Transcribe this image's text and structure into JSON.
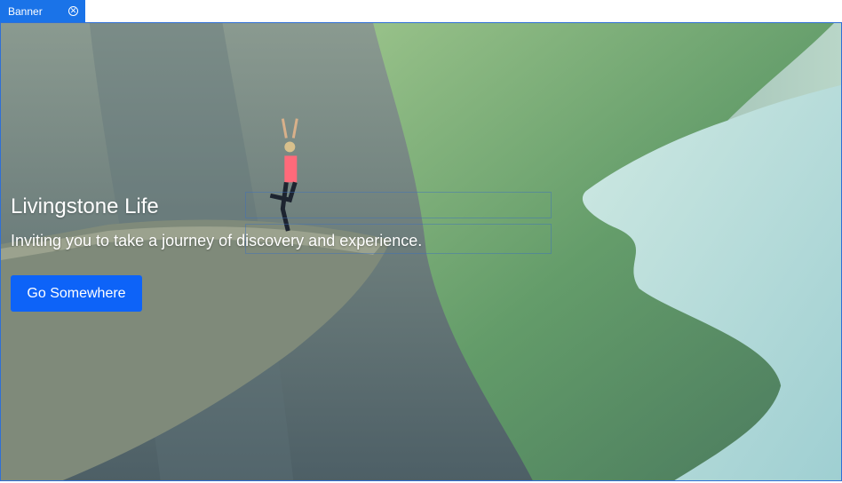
{
  "tab": {
    "label": "Banner",
    "close_icon": "close-circle-icon"
  },
  "banner": {
    "title": "Livingstone Life",
    "subtitle": "Inviting you to take a journey of discovery and experience.",
    "button_label": "Go Somewhere",
    "background_image": "cliff-yoga-fjord-photo"
  },
  "colors": {
    "accent": "#1a73e8",
    "button": "#0d63f8",
    "text": "#ffffff"
  }
}
